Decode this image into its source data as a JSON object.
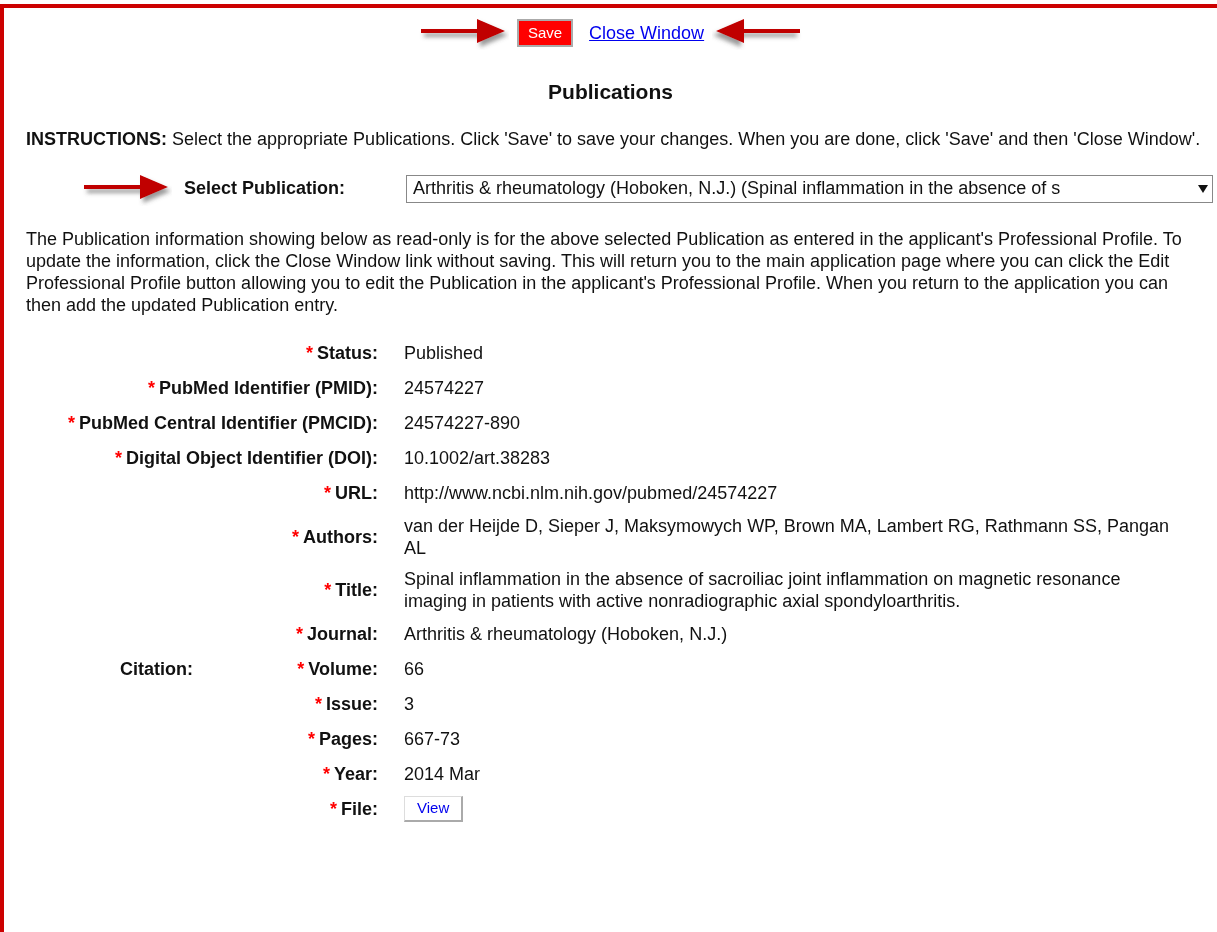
{
  "toolbar": {
    "save_button": "Save",
    "close_link": "Close Window"
  },
  "heading": "Publications",
  "required_mark": "*",
  "instructions": "**INSTRUCTIONS:** Select the appropriate Publications. Click 'Save' to save your changes. When you are done, click 'Save' and then 'Close Window'.",
  "select_publication": {
    "label": "Select Publication:",
    "value": "Arthritis & rheumatology (Hoboken, N.J.) (Spinal inflammation in the absence of s"
  },
  "note": "The Publication information showing below as read-only is for the above selected Publication as entered in the applicant's Professional Profile. To update the information, click the Close Window link without saving. This will return you to the main application page where you can click the Edit Professional Profile button allowing you to edit the Publication in the applicant's Professional Profile. When you return to the application you can then add the updated Publication entry.",
  "fields": [
    {
      "label": "Status:",
      "value": "Published",
      "required": true,
      "kind": "text"
    },
    {
      "label": "PubMed Identifier (PMID):",
      "value": "24574227",
      "required": true,
      "kind": "text"
    },
    {
      "label": "PubMed Central Identifier (PMCID):",
      "value": "24574227-890",
      "required": true,
      "kind": "text"
    },
    {
      "label": "Digital Object Identifier (DOI):",
      "value": "10.1002/art.38283",
      "required": true,
      "kind": "text"
    },
    {
      "label": "URL:",
      "value": "http://www.ncbi.nlm.nih.gov/pubmed/24574227",
      "required": true,
      "kind": "text"
    },
    {
      "label": "Authors:",
      "value": "van der Heijde D, Sieper J, Maksymowych WP, Brown MA, Lambert RG, Rathmann SS, Pangan AL",
      "required": true,
      "kind": "text"
    },
    {
      "label": "Title:",
      "value": "Spinal inflammation in the absence of sacroiliac joint inflammation on magnetic resonance imaging in patients with active nonradiographic axial spondyloarthritis.",
      "required": true,
      "kind": "text"
    }
  ],
  "citation": {
    "label": "Citation:",
    "fields": [
      {
        "label": "Journal:",
        "value": "Arthritis & rheumatology (Hoboken, N.J.)",
        "required": true,
        "kind": "text"
      },
      {
        "label": "Volume:",
        "value": "66",
        "required": true,
        "kind": "text"
      },
      {
        "label": "Issue:",
        "value": "3",
        "required": true,
        "kind": "text"
      }
    ]
  },
  "more_fields": [
    {
      "label": "Pages:",
      "value": "667-73",
      "required": true,
      "kind": "text"
    },
    {
      "label": "Year:",
      "value": "2014 Mar",
      "required": true,
      "kind": "text"
    },
    {
      "label": "File:",
      "value": "View",
      "required": true,
      "kind": "button"
    }
  ]
}
